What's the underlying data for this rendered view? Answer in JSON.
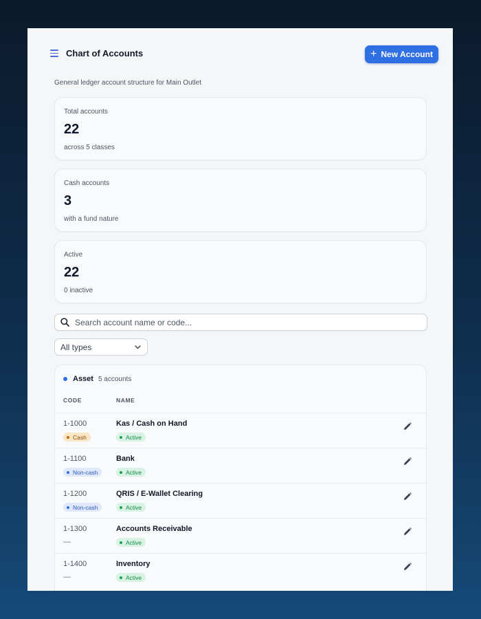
{
  "header": {
    "title": "Chart of Accounts",
    "new_button_label": "New Account",
    "subtitle": "General ledger account structure for Main Outlet"
  },
  "stats": [
    {
      "label": "Total accounts",
      "value": "22",
      "note": "across 5 classes"
    },
    {
      "label": "Cash accounts",
      "value": "3",
      "note": "with a fund nature"
    },
    {
      "label": "Active",
      "value": "22",
      "note": "0 inactive"
    }
  ],
  "search": {
    "placeholder": "Search account name or code..."
  },
  "type_filter": {
    "selected": "All types"
  },
  "group": {
    "name": "Asset",
    "count": "5 accounts",
    "columns": {
      "code": "CODE",
      "name": "NAME"
    },
    "rows": [
      {
        "code": "1-1000",
        "name": "Kas / Cash on Hand",
        "nature": "Cash",
        "status": "Active"
      },
      {
        "code": "1-1100",
        "name": "Bank",
        "nature": "Non-cash",
        "status": "Active"
      },
      {
        "code": "1-1200",
        "name": "QRIS / E-Wallet Clearing",
        "nature": "Non-cash",
        "status": "Active"
      },
      {
        "code": "1-1300",
        "name": "Accounts Receivable",
        "nature": "—",
        "status": "Active"
      },
      {
        "code": "1-1400",
        "name": "Inventory",
        "nature": "—",
        "status": "Active"
      }
    ]
  },
  "colors": {
    "accent": "#2f6fe4",
    "active": "#1aa053",
    "cash": "#c26a10"
  },
  "icons": {
    "menu": "menu-icon",
    "plus": "plus-icon",
    "search": "search-icon",
    "chevron": "chevron-down-icon",
    "edit": "pencil-icon"
  }
}
